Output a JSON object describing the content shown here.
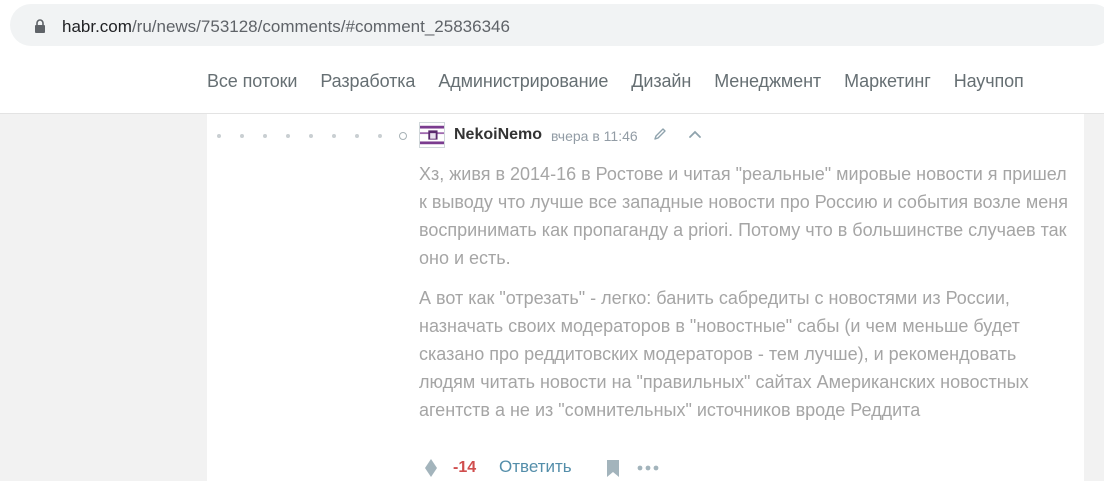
{
  "browser": {
    "url_host": "habr.com",
    "url_path": "/ru/news/753128/comments/#comment_25836346"
  },
  "nav": {
    "items": [
      {
        "label": "Все потоки"
      },
      {
        "label": "Разработка"
      },
      {
        "label": "Администрирование"
      },
      {
        "label": "Дизайн"
      },
      {
        "label": "Менеджмент"
      },
      {
        "label": "Маркетинг"
      },
      {
        "label": "Научпоп"
      }
    ]
  },
  "comment": {
    "username": "NekoiNemo",
    "timestamp": "вчера в 11:46",
    "paragraphs": [
      "Хз, живя в 2014-16 в Ростове и читая \"реальные\" мировые новости я пришел к выводу что лучше все западные новости про Россию и события возле меня воспринимать как пропаганду a priori. Потому что в большинстве случаев так оно и есть.",
      "А вот как \"отрезать\" - легко: банить сабредиты с новостями из России, назначать своих модераторов в \"новостные\" сабы (и чем меньше будет сказано про реддитовских модераторов - тем лучше), и рекомендовать людям читать новости на \"правильных\" сайтах Американских новостных агентств а не из \"сомнительных\" источников вроде Реддита"
    ],
    "score": "-14",
    "reply_label": "Ответить"
  },
  "colors": {
    "score_negative": "#d04e4e",
    "link": "#548eaa",
    "muted_text": "#a5a5a5"
  },
  "icons": [
    "lock-icon",
    "edit-icon",
    "chevron-up-icon",
    "vote-icon",
    "bookmark-icon",
    "more-icon"
  ]
}
